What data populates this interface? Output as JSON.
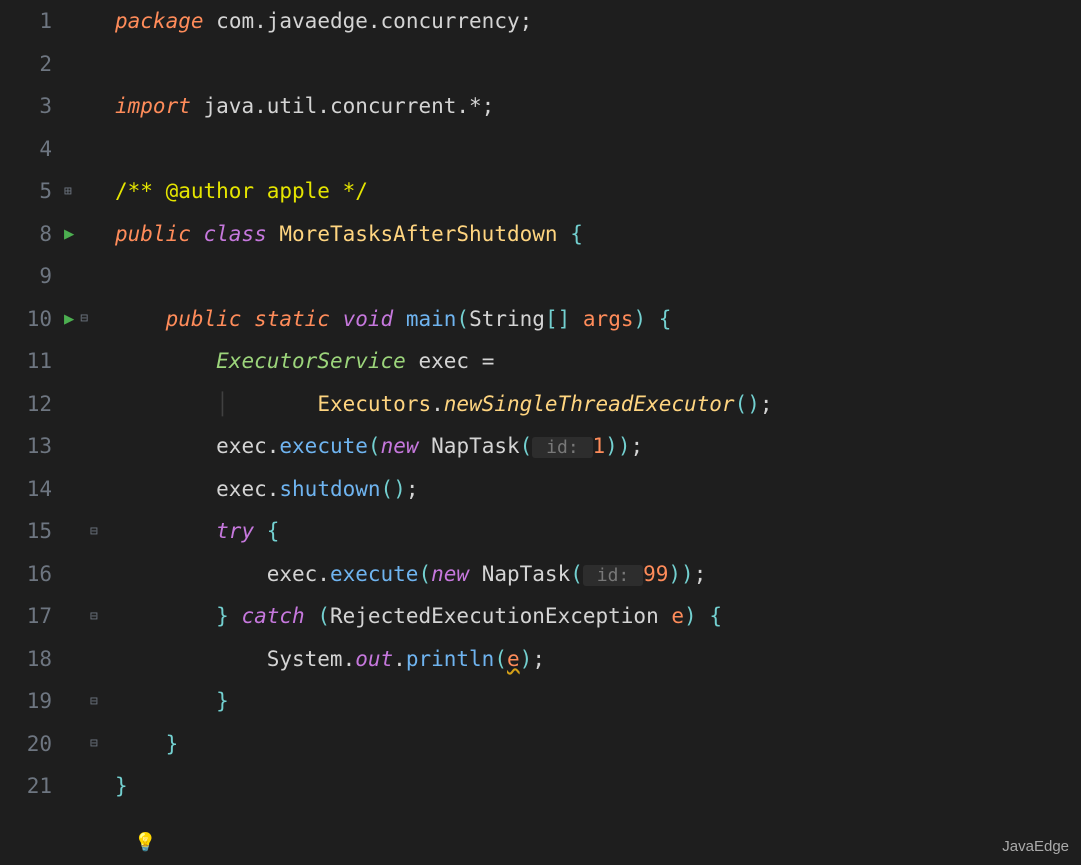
{
  "watermark": "JavaEdge",
  "lines": {
    "l1": {
      "num": "1"
    },
    "l2": {
      "num": "2"
    },
    "l3": {
      "num": "3"
    },
    "l4": {
      "num": "4"
    },
    "l5": {
      "num": "5"
    },
    "l8": {
      "num": "8"
    },
    "l9": {
      "num": "9"
    },
    "l10": {
      "num": "10"
    },
    "l11": {
      "num": "11"
    },
    "l12": {
      "num": "12"
    },
    "l13": {
      "num": "13"
    },
    "l14": {
      "num": "14"
    },
    "l15": {
      "num": "15"
    },
    "l16": {
      "num": "16"
    },
    "l17": {
      "num": "17"
    },
    "l18": {
      "num": "18"
    },
    "l19": {
      "num": "19"
    },
    "l20": {
      "num": "20"
    },
    "l21": {
      "num": "21"
    }
  },
  "tokens": {
    "package": "package",
    "pkg_name": "com.javaedge.concurrency",
    "import": "import",
    "import_name": "java.util.concurrent.*",
    "doc_open": "/** ",
    "doc_tag": "@author",
    "doc_text": " apple ",
    "doc_close": "*/",
    "public": "public",
    "class": "class",
    "class_name": "MoreTasksAfterShutdown",
    "static": "static",
    "void": "void",
    "main": "main",
    "String": "String",
    "args": "args",
    "ExecutorService": "ExecutorService",
    "exec": "exec",
    "Executors": "Executors",
    "newSingle": "newSingleThreadExecutor",
    "execute": "execute",
    "new": "new",
    "NapTask": "NapTask",
    "id_hint": " id: ",
    "one": "1",
    "shutdown": "shutdown",
    "try": "try",
    "ninetynine": "99",
    "catch": "catch",
    "RejectedExecutionException": "RejectedExecutionException",
    "e": "e",
    "System": "System",
    "out": "out",
    "println": "println",
    "semi": ";",
    "lbrace": "{",
    "rbrace": "}",
    "lparen": "(",
    "rparen": ")",
    "lbracket": "[",
    "rbracket": "]",
    "dot": ".",
    "eq": "=",
    "comma": ","
  }
}
